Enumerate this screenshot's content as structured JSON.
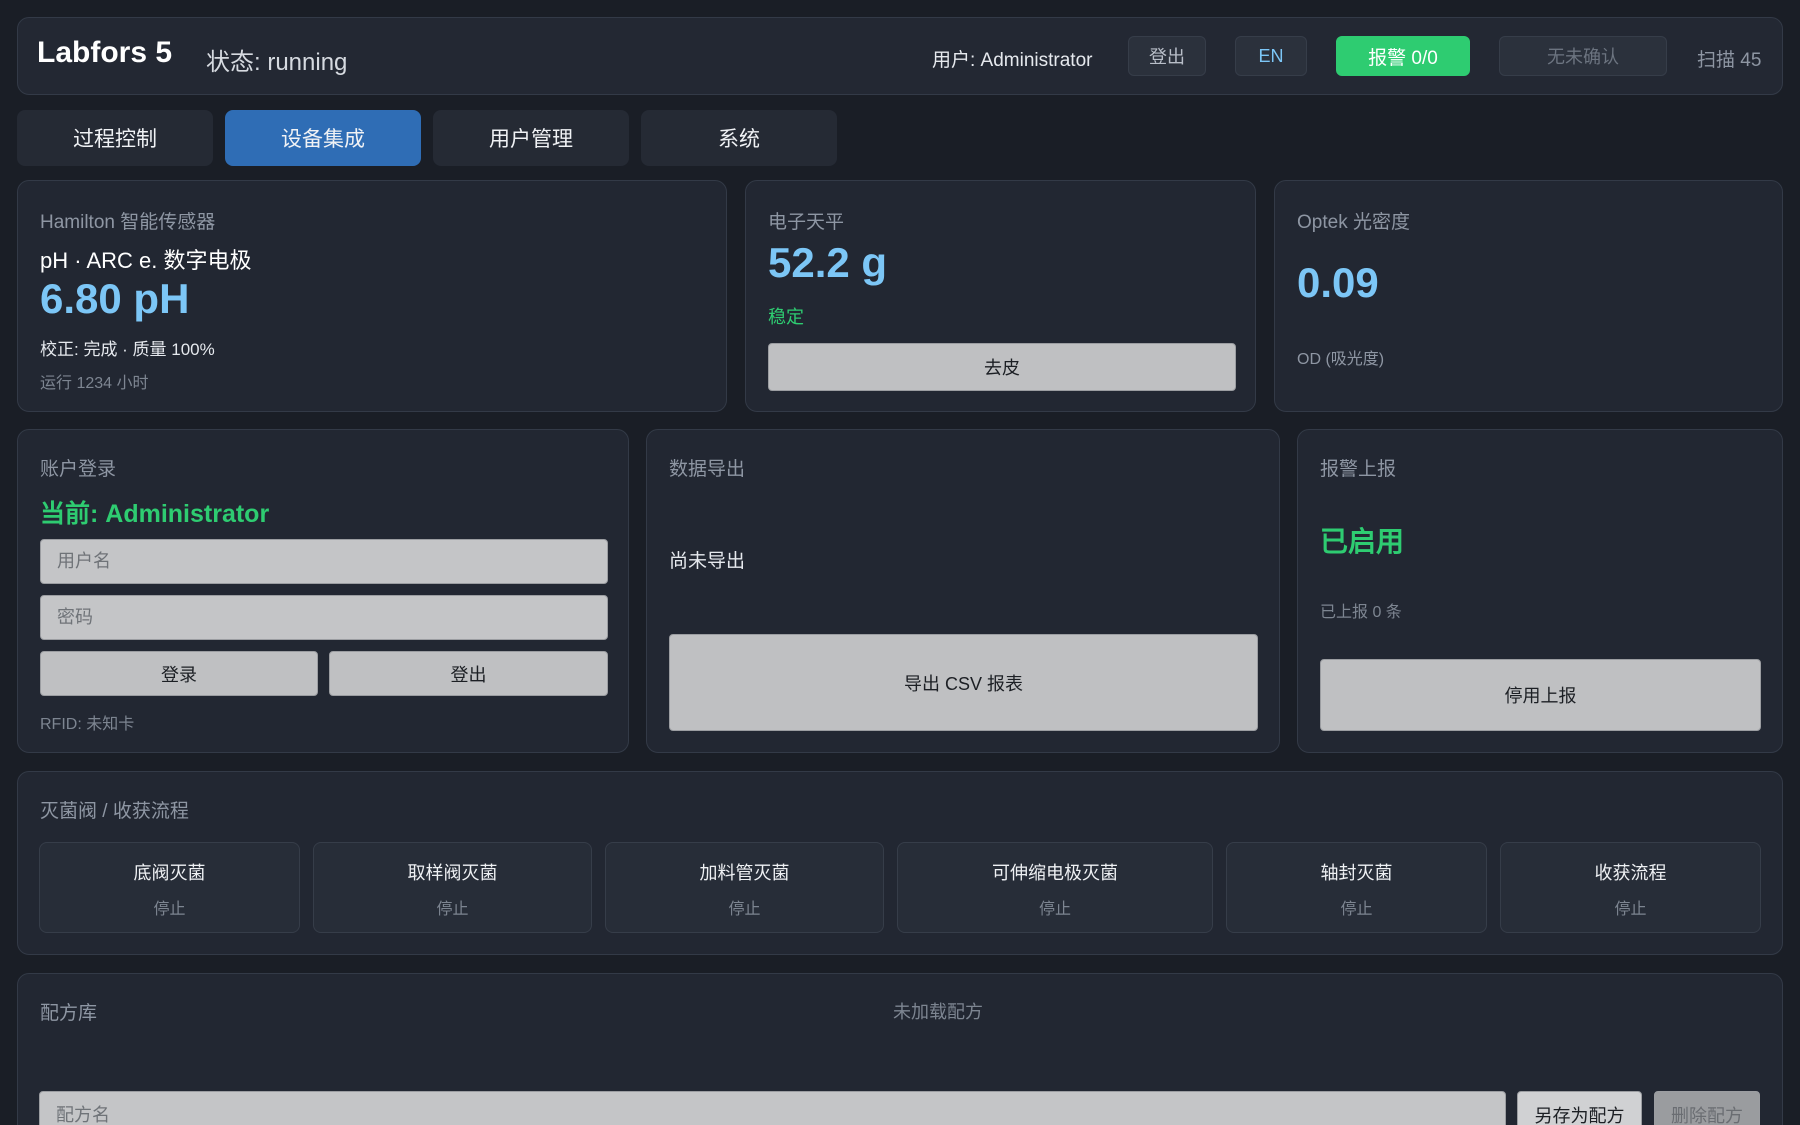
{
  "header": {
    "app_title": "Labfors 5",
    "status": "状态: running",
    "user": "用户: Administrator",
    "logout_label": "登出",
    "lang_label": "EN",
    "alarm_label": "报警 0/0",
    "ack_label": "无未确认",
    "scan_label": "扫描 45",
    "alarm_color": "#2ecc71"
  },
  "tabs": [
    {
      "label": "过程控制"
    },
    {
      "label": "设备集成"
    },
    {
      "label": "用户管理"
    },
    {
      "label": "系统"
    }
  ],
  "hamilton": {
    "title": "Hamilton 智能传感器",
    "subtitle": "pH · ARC e. 数字电极",
    "value": "6.80 pH",
    "calibration": "校正: 完成 · 质量 100%",
    "runtime": "运行 1234 小时"
  },
  "balance": {
    "title": "电子天平",
    "value": "52.2 g",
    "state": "稳定",
    "tare_label": "去皮"
  },
  "optek": {
    "title": "Optek 光密度",
    "value": "0.09",
    "unit": "OD (吸光度)"
  },
  "login": {
    "title": "账户登录",
    "current": "当前: Administrator",
    "username_placeholder": "用户名",
    "password_placeholder": "密码",
    "login_label": "登录",
    "logout_label": "登出",
    "rfid": "RFID: 未知卡"
  },
  "export": {
    "title": "数据导出",
    "status": "尚未导出",
    "button_label": "导出 CSV 报表"
  },
  "alarm_report": {
    "title": "报警上报",
    "state": "已启用",
    "count": "已上报 0 条",
    "button_label": "停用上报"
  },
  "sterilization": {
    "title": "灭菌阀 / 收获流程",
    "items": [
      {
        "name": "底阀灭菌",
        "state": "停止"
      },
      {
        "name": "取样阀灭菌",
        "state": "停止"
      },
      {
        "name": "加料管灭菌",
        "state": "停止"
      },
      {
        "name": "可伸缩电极灭菌",
        "state": "停止"
      },
      {
        "name": "轴封灭菌",
        "state": "停止"
      },
      {
        "name": "收获流程",
        "state": "停止"
      }
    ]
  },
  "recipes": {
    "title": "配方库",
    "status": "未加载配方",
    "name_placeholder": "配方名",
    "save_label": "另存为配方",
    "delete_label": "删除配方"
  }
}
